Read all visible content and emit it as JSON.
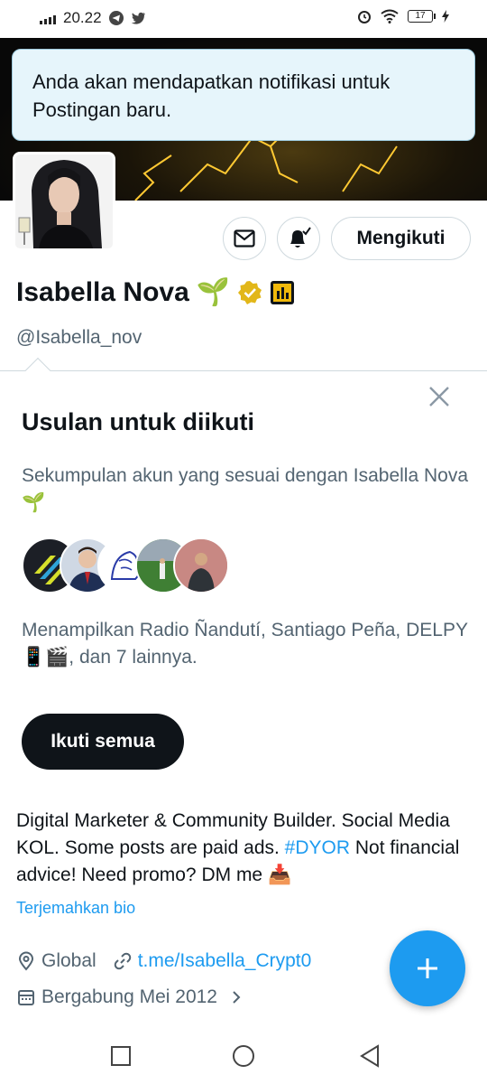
{
  "status_bar": {
    "time": "20.22",
    "battery": "17"
  },
  "toast": {
    "message": "Anda akan mendapatkan notifikasi untuk Postingan baru."
  },
  "profile": {
    "name": "Isabella Nova",
    "name_emoji": "🌱",
    "handle": "@Isabella_nov",
    "follow_label": "Mengikuti",
    "bio_text": "Digital Marketer & Community Builder. Social Media KOL. Some posts are paid ads. ",
    "bio_tag": "#DYOR",
    "bio_text2": " Not financial advice! Need promo? DM me 📥",
    "translate_label": "Terjemahkan bio",
    "location": "Global",
    "link": "t.me/Isabella_Crypt0",
    "joined": "Bergabung Mei 2012"
  },
  "suggestions": {
    "title": "Usulan untuk diikuti",
    "description": "Sekumpulan akun yang sesuai dengan Isabella Nova 🌱",
    "names": "Menampilkan Radio Ñandutí, Santiago Peña, DELPY 📱🎬, dan 7 lainnya.",
    "follow_all_label": "Ikuti semua"
  },
  "icons": {
    "message": "envelope-icon",
    "notifications": "bell-check-icon",
    "close": "close-icon",
    "location": "map-pin-icon",
    "link": "link-icon",
    "calendar": "calendar-icon",
    "compose": "plus-icon"
  },
  "colors": {
    "accent": "#1d9bf0",
    "verified": "#e2b719",
    "toast_bg": "#e6f5fb"
  }
}
